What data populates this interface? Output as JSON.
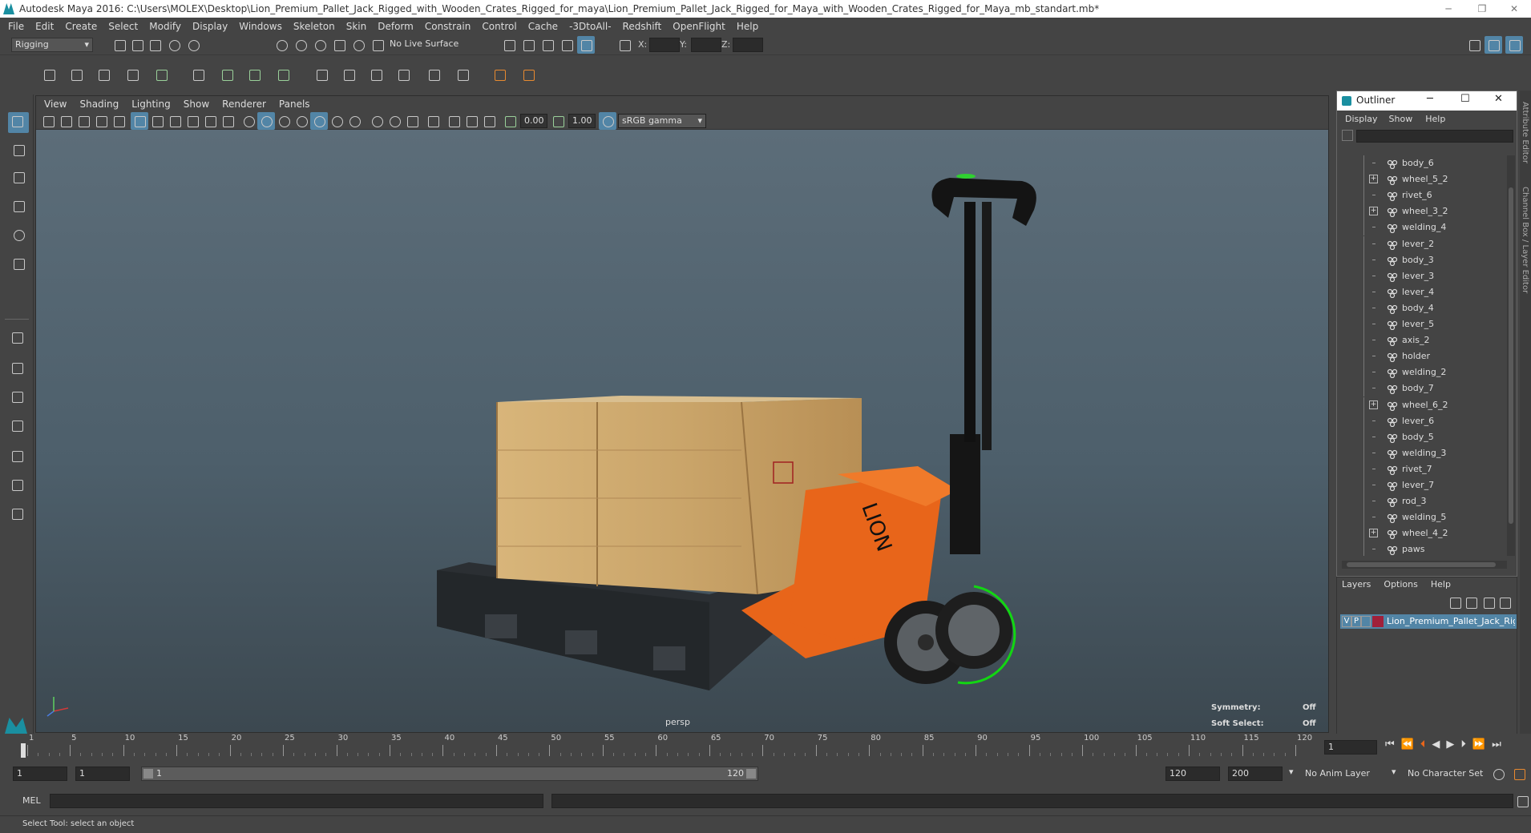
{
  "window": {
    "title": "Autodesk Maya 2016: C:\\Users\\MOLEX\\Desktop\\Lion_Premium_Pallet_Jack_Rigged_with_Wooden_Crates_Rigged_for_maya\\Lion_Premium_Pallet_Jack_Rigged_for_Maya_with_Wooden_Crates_Rigged_for_Maya_mb_standart.mb*",
    "minimize": "─",
    "restore": "❐",
    "close": "✕"
  },
  "menubar": [
    "File",
    "Edit",
    "Create",
    "Select",
    "Modify",
    "Display",
    "Windows",
    "Skeleton",
    "Skin",
    "Deform",
    "Constrain",
    "Control",
    "Cache",
    "-3DtoAll-",
    "Redshift",
    "OpenFlight",
    "Help"
  ],
  "statusline": {
    "mode": "Rigging",
    "live_surface": "No Live Surface",
    "x_label": "X:",
    "y_label": "Y:",
    "z_label": "Z:"
  },
  "viewport": {
    "menu": [
      "View",
      "Shading",
      "Lighting",
      "Show",
      "Renderer",
      "Panels"
    ],
    "exposure": "0.00",
    "gamma": "1.00",
    "colorspace": "sRGB gamma",
    "camera_label": "persp",
    "symmetry_label": "Symmetry:",
    "symmetry_value": "Off",
    "soft_select_label": "Soft Select:",
    "soft_select_value": "Off",
    "crate_text": "LION"
  },
  "outliner": {
    "title": "Outliner",
    "menu": [
      "Display",
      "Show",
      "Help"
    ],
    "items": [
      {
        "name": "body_6",
        "expand": false
      },
      {
        "name": "wheel_5_2",
        "expand": true
      },
      {
        "name": "rivet_6",
        "expand": false
      },
      {
        "name": "wheel_3_2",
        "expand": true
      },
      {
        "name": "welding_4",
        "expand": false
      },
      {
        "name": "lever_2",
        "expand": false
      },
      {
        "name": "body_3",
        "expand": false
      },
      {
        "name": "lever_3",
        "expand": false
      },
      {
        "name": "lever_4",
        "expand": false
      },
      {
        "name": "body_4",
        "expand": false
      },
      {
        "name": "lever_5",
        "expand": false
      },
      {
        "name": "axis_2",
        "expand": false
      },
      {
        "name": "holder",
        "expand": false
      },
      {
        "name": "welding_2",
        "expand": false
      },
      {
        "name": "body_7",
        "expand": false
      },
      {
        "name": "wheel_6_2",
        "expand": true
      },
      {
        "name": "lever_6",
        "expand": false
      },
      {
        "name": "body_5",
        "expand": false
      },
      {
        "name": "welding_3",
        "expand": false
      },
      {
        "name": "rivet_7",
        "expand": false
      },
      {
        "name": "lever_7",
        "expand": false
      },
      {
        "name": "rod_3",
        "expand": false
      },
      {
        "name": "welding_5",
        "expand": false
      },
      {
        "name": "wheel_4_2",
        "expand": true
      },
      {
        "name": "paws",
        "expand": false
      }
    ]
  },
  "layers": {
    "menu": [
      "Layers",
      "Options",
      "Help"
    ],
    "layer_v": "V",
    "layer_p": "P",
    "layer_name": "Lion_Premium_Pallet_Jack_Rigge",
    "layer_color": "#a0203a"
  },
  "side_tabs": {
    "attribute": "Attribute Editor",
    "channel": "Channel Box / Layer Editor"
  },
  "timeline": {
    "ticks": [
      "1",
      "5",
      "10",
      "15",
      "20",
      "25",
      "30",
      "35",
      "40",
      "45",
      "50",
      "55",
      "60",
      "65",
      "70",
      "75",
      "80",
      "85",
      "90",
      "95",
      "100",
      "105",
      "110",
      "115",
      "120"
    ],
    "current_frame": "1"
  },
  "range": {
    "start": "1",
    "playback_start": "1",
    "slider_start": "1",
    "slider_end": "120",
    "playback_end": "120",
    "end": "200",
    "anim_layer": "No Anim Layer",
    "character_set": "No Character Set"
  },
  "command": {
    "mode": "MEL"
  },
  "help": {
    "text": "Select Tool: select an object"
  },
  "colors": {
    "accent": "#5285a6",
    "jack_orange": "#e8651a",
    "crate_wood": "#c9a36a"
  }
}
